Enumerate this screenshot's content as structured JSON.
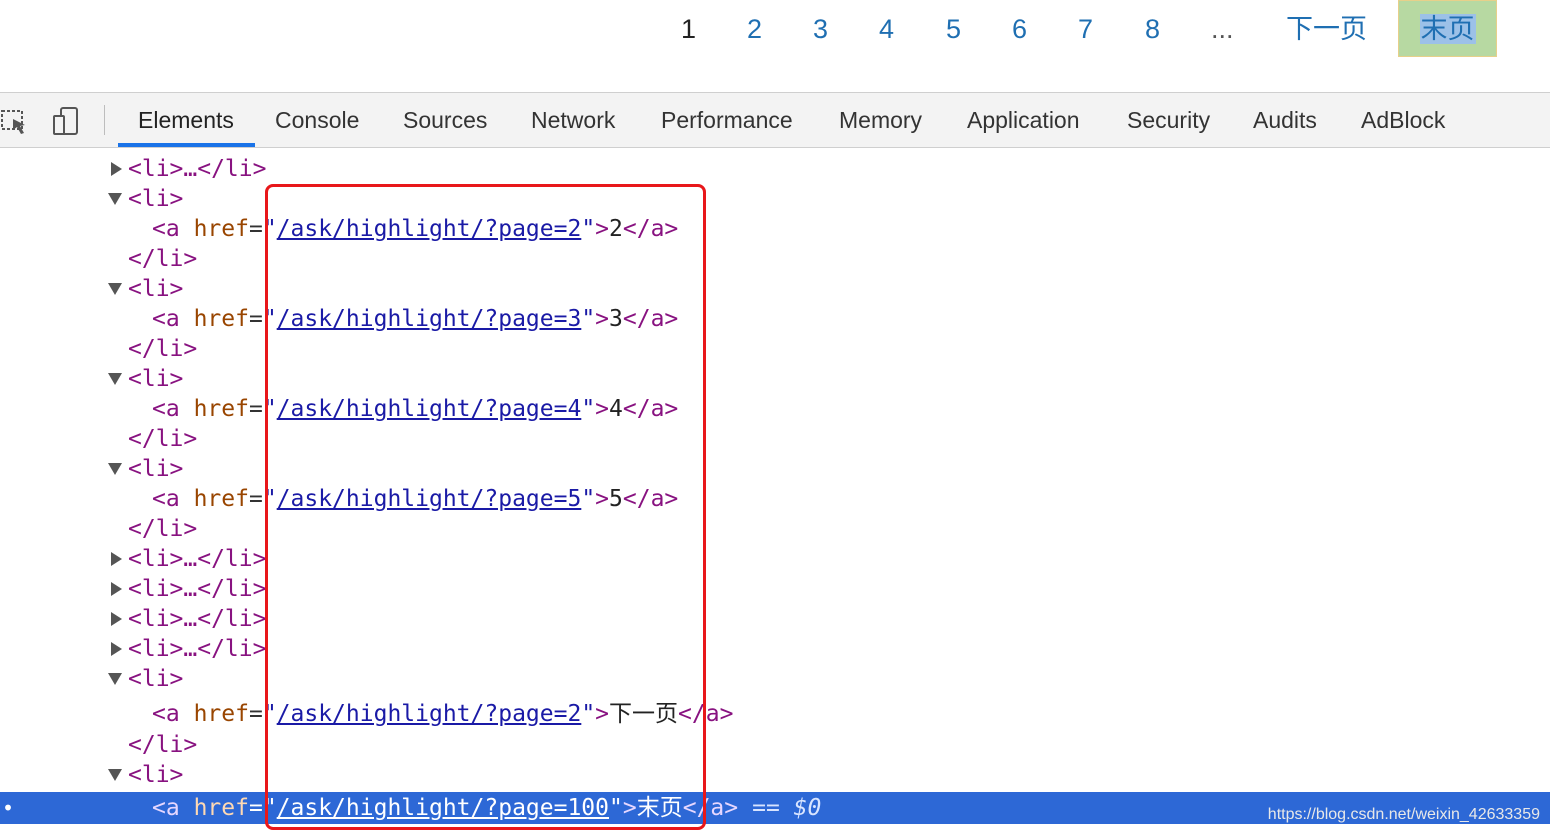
{
  "pagination": {
    "pages": [
      "1",
      "2",
      "3",
      "4",
      "5",
      "6",
      "7",
      "8"
    ],
    "current_page": "1",
    "ellipsis": "...",
    "next_label": "下一页",
    "last_label": "末页"
  },
  "devtools": {
    "tabs": [
      "Elements",
      "Console",
      "Sources",
      "Network",
      "Performance",
      "Memory",
      "Application",
      "Security",
      "Audits",
      "AdBlock"
    ],
    "active_tab": "Elements",
    "tools": [
      "inspect-element-icon",
      "device-toolbar-icon"
    ]
  },
  "elements_tree": {
    "li_open": "<li>",
    "li_close": "</li>",
    "li_collapsed": "<li>…</li>",
    "a_open": "<a",
    "a_close": "</a>",
    "href_attr": "href",
    "links": [
      {
        "href": "/ask/highlight/?page=2",
        "text": "2"
      },
      {
        "href": "/ask/highlight/?page=3",
        "text": "3"
      },
      {
        "href": "/ask/highlight/?page=4",
        "text": "4"
      },
      {
        "href": "/ask/highlight/?page=5",
        "text": "5"
      },
      {
        "href": "/ask/highlight/?page=2",
        "text": "下一页"
      },
      {
        "href": "/ask/highlight/?page=100",
        "text": "末页"
      }
    ],
    "selected_suffix": "== $0"
  },
  "watermark": "https://blog.csdn.net/weixin_42633359",
  "colors": {
    "link_blue": "#1f6fb2",
    "selected_row": "#2d68d6",
    "highlight_box": "#e8171a",
    "active_tab_underline": "#1a73e8"
  }
}
